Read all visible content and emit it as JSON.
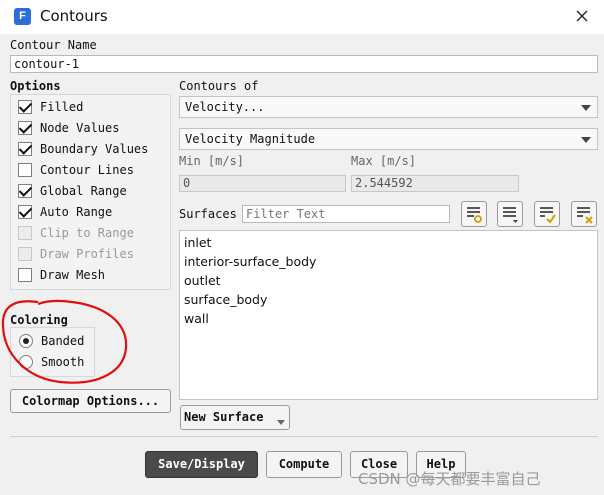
{
  "window": {
    "title": "Contours",
    "app_icon_letter": "F"
  },
  "contour_name": {
    "label": "Contour Name",
    "value": "contour-1"
  },
  "options": {
    "label": "Options",
    "items": [
      {
        "label": "Filled",
        "checked": true,
        "enabled": true
      },
      {
        "label": "Node Values",
        "checked": true,
        "enabled": true
      },
      {
        "label": "Boundary Values",
        "checked": true,
        "enabled": true
      },
      {
        "label": "Contour Lines",
        "checked": false,
        "enabled": true
      },
      {
        "label": "Global Range",
        "checked": true,
        "enabled": true
      },
      {
        "label": "Auto Range",
        "checked": true,
        "enabled": true
      },
      {
        "label": "Clip to Range",
        "checked": false,
        "enabled": false
      },
      {
        "label": "Draw Profiles",
        "checked": false,
        "enabled": false
      },
      {
        "label": "Draw Mesh",
        "checked": false,
        "enabled": true
      }
    ]
  },
  "coloring": {
    "label": "Coloring",
    "items": [
      {
        "label": "Banded",
        "selected": true
      },
      {
        "label": "Smooth",
        "selected": false
      }
    ]
  },
  "colormap_button": "Colormap Options...",
  "contours_of": {
    "label": "Contours of",
    "category": "Velocity...",
    "quantity": "Velocity Magnitude"
  },
  "range": {
    "min_label": "Min [m/s]",
    "min_value": "0",
    "max_label": "Max [m/s]",
    "max_value": "2.544592"
  },
  "surfaces": {
    "label": "Surfaces",
    "filter_placeholder": "Filter Text",
    "items": [
      "inlet",
      "interior-surface_body",
      "outlet",
      "surface_body",
      "wall"
    ]
  },
  "new_surface_button": "New Surface",
  "buttons": {
    "save_display": "Save/Display",
    "compute": "Compute",
    "close": "Close",
    "help": "Help"
  },
  "watermark": "CSDN @每天都要丰富自己",
  "colors": {
    "primary_button": "#4a4a4a",
    "annotation_circle": "#e01010",
    "app_icon": "#2b6fd6"
  }
}
